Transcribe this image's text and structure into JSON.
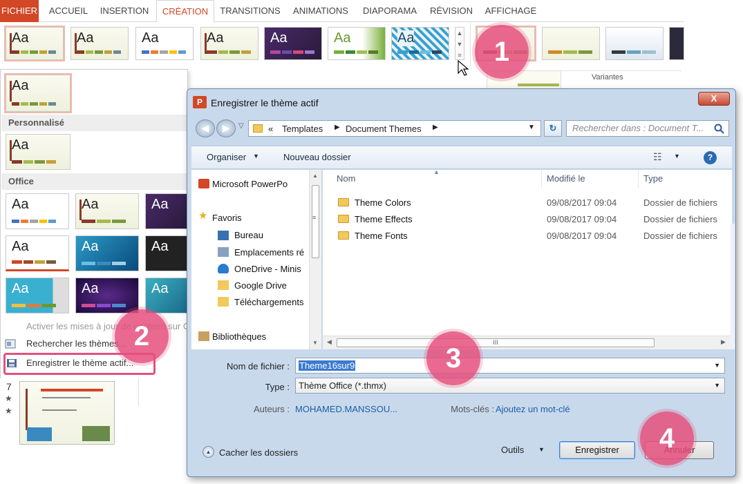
{
  "ribbon": {
    "tabs": [
      "FICHIER",
      "ACCUEIL",
      "INSERTION",
      "CRÉATION",
      "TRANSITIONS",
      "ANIMATIONS",
      "DIAPORAMA",
      "RÉVISION",
      "AFFICHAGE"
    ],
    "active_tab": "CRÉATION",
    "variants_label": "Variantes",
    "theme_thumb_text": "Aa"
  },
  "panel": {
    "section_custom": "Personnalisé",
    "section_office": "Office",
    "menu": {
      "update": "Activer les mises à jour de contenu sur Office",
      "browse": "Rechercher les thèmes...",
      "save": "Enregistrer le thème actif..."
    }
  },
  "slides": {
    "number": "7",
    "star": "★"
  },
  "dialog": {
    "title": "Enregistrer le thème actif",
    "close_label": "X",
    "breadcrumb": [
      "«",
      "Templates",
      "Document Themes"
    ],
    "search_placeholder": "Rechercher dans : Document T...",
    "toolbar": {
      "organize": "Organiser",
      "new_folder": "Nouveau dossier"
    },
    "nav": {
      "app": "Microsoft PowerPo",
      "favorites": "Favoris",
      "items": [
        "Bureau",
        "Emplacements ré",
        "OneDrive - Minis",
        "Google Drive",
        "Téléchargements"
      ],
      "libraries": "Bibliothèques"
    },
    "columns": {
      "name": "Nom",
      "modified": "Modifié le",
      "type": "Type"
    },
    "files": [
      {
        "name": "Theme Colors",
        "modified": "09/08/2017 09:04",
        "type": "Dossier de fichiers"
      },
      {
        "name": "Theme Effects",
        "modified": "09/08/2017 09:04",
        "type": "Dossier de fichiers"
      },
      {
        "name": "Theme Fonts",
        "modified": "09/08/2017 09:04",
        "type": "Dossier de fichiers"
      }
    ],
    "hscroll_grip": "III",
    "filename_label": "Nom de fichier :",
    "filename_value": "Theme16sur9",
    "type_label": "Type :",
    "type_value": "Thème Office (*.thmx)",
    "authors_label": "Auteurs :",
    "authors_value": "MOHAMED.MANSSOU...",
    "keywords_label": "Mots-clés :",
    "keywords_value": "Ajoutez un mot-clé",
    "hide_folders": "Cacher les dossiers",
    "tools": "Outils",
    "save": "Enregistrer",
    "cancel": "Annuler"
  },
  "callouts": [
    "1",
    "2",
    "3",
    "4"
  ],
  "colors": {
    "accent": "#d24726",
    "callout": "#e54f7d",
    "link": "#1a5ea8"
  }
}
